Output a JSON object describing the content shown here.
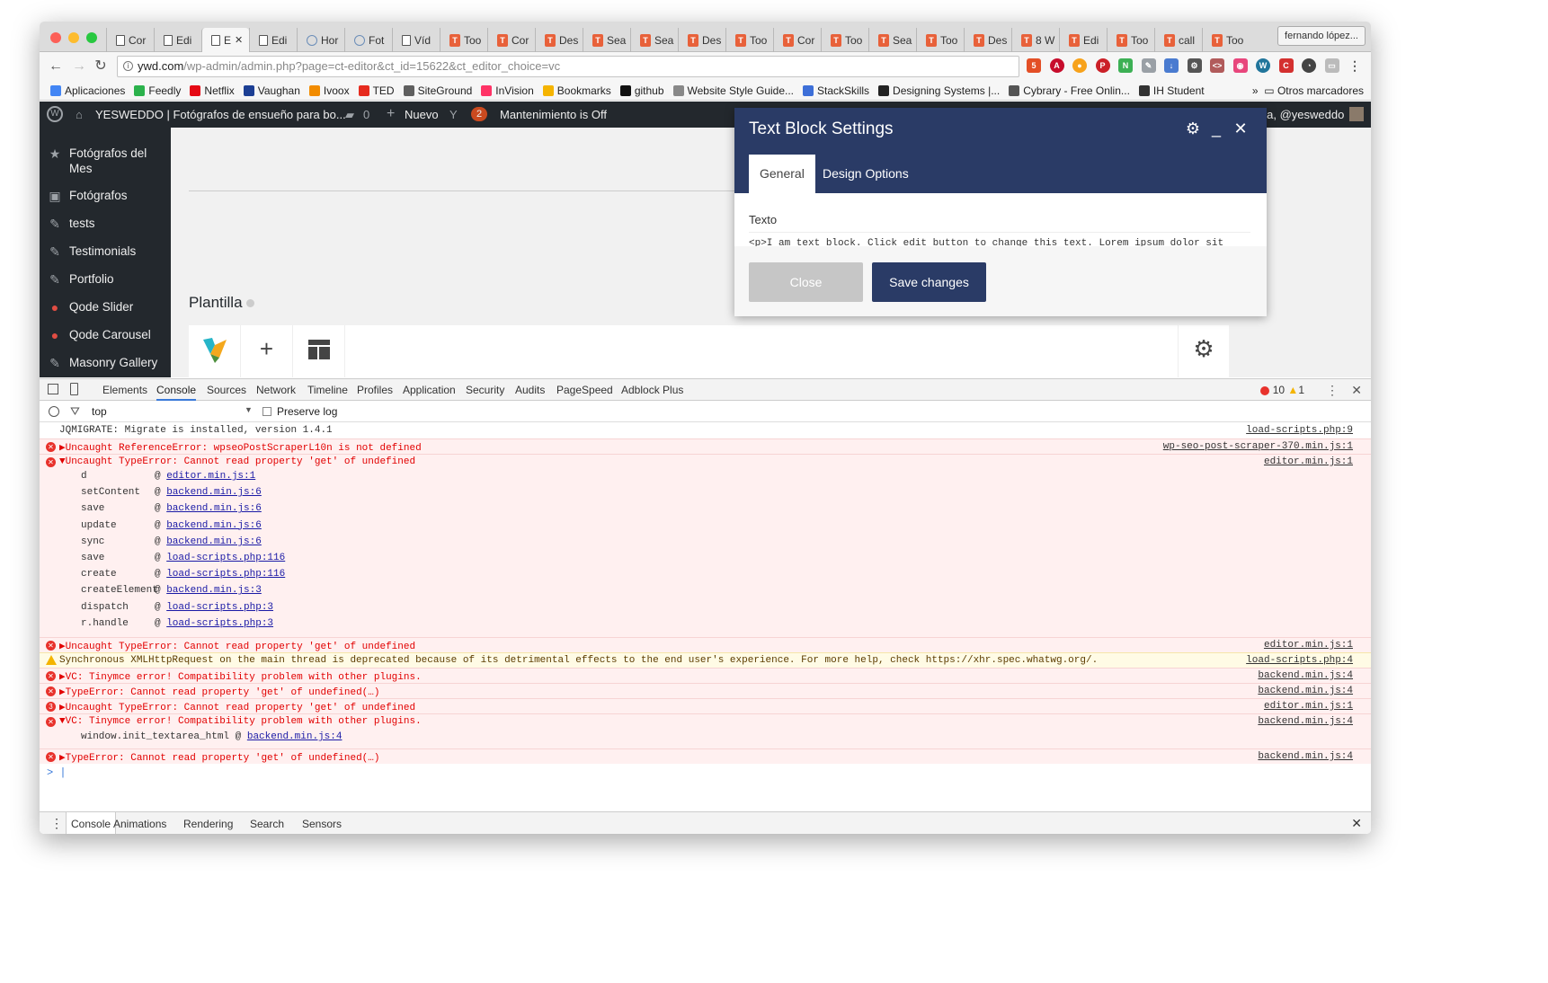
{
  "browser": {
    "tabs": [
      {
        "label": "Cor",
        "icon": "doc"
      },
      {
        "label": "Edi",
        "icon": "doc"
      },
      {
        "label": "E",
        "icon": "doc",
        "active": true
      },
      {
        "label": "Edi",
        "icon": "doc"
      },
      {
        "label": "Hor",
        "icon": "globe"
      },
      {
        "label": "Fot",
        "icon": "globe"
      },
      {
        "label": "Víd",
        "icon": "doc"
      },
      {
        "label": "Too",
        "icon": "toolset"
      },
      {
        "label": "Cor",
        "icon": "toolset"
      },
      {
        "label": "Des",
        "icon": "toolset"
      },
      {
        "label": "Sea",
        "icon": "toolset"
      },
      {
        "label": "Sea",
        "icon": "toolset"
      },
      {
        "label": "Des",
        "icon": "toolset"
      },
      {
        "label": "Too",
        "icon": "toolset"
      },
      {
        "label": "Cor",
        "icon": "toolset"
      },
      {
        "label": "Too",
        "icon": "toolset"
      },
      {
        "label": "Sea",
        "icon": "toolset"
      },
      {
        "label": "Too",
        "icon": "toolset"
      },
      {
        "label": "Des",
        "icon": "toolset"
      },
      {
        "label": "8 W",
        "icon": "toolset"
      },
      {
        "label": "Edi",
        "icon": "toolset"
      },
      {
        "label": "Too",
        "icon": "toolset"
      },
      {
        "label": "call",
        "icon": "toolset"
      },
      {
        "label": "Too",
        "icon": "toolset"
      }
    ],
    "profile": "fernando lópez...",
    "url_host": "ywd.com",
    "url_path": "/wp-admin/admin.php?page=ct-editor&ct_id=15622&ct_editor_choice=vc",
    "bookmarks": [
      {
        "label": "Aplicaciones",
        "color": "#4285f4"
      },
      {
        "label": "Feedly",
        "color": "#2bb24c"
      },
      {
        "label": "Netflix",
        "color": "#e50914"
      },
      {
        "label": "Vaughan",
        "color": "#1c3f94"
      },
      {
        "label": "Ivoox",
        "color": "#f28c00"
      },
      {
        "label": "TED",
        "color": "#e62b1e"
      },
      {
        "label": "SiteGround",
        "color": "#5f5f5f"
      },
      {
        "label": "InVision",
        "color": "#ff3366"
      },
      {
        "label": "Bookmarks",
        "color": "#f5b400"
      },
      {
        "label": "github",
        "color": "#111111"
      },
      {
        "label": "Website Style Guide...",
        "color": "#888888"
      },
      {
        "label": "StackSkills",
        "color": "#3d6fd8"
      },
      {
        "label": "Designing Systems |...",
        "color": "#222222"
      },
      {
        "label": "Cybrary - Free Onlin...",
        "color": "#555555"
      },
      {
        "label": "IH Student",
        "color": "#333333"
      }
    ],
    "bookmarks_more": "»",
    "bookmarks_other": "Otros marcadores"
  },
  "adminbar": {
    "site": "YESWEDDO | Fotógrafos de ensueño para bo...",
    "comments": "0",
    "new": "Nuevo",
    "updates": "2",
    "maintenance": "Mantenimiento is Off",
    "greeting": "ola, @yesweddo"
  },
  "sidebar": {
    "items": [
      {
        "label": "Fotógrafos del",
        "label2": "Mes",
        "icon": "★"
      },
      {
        "label": "Fotógrafos",
        "icon": "▣"
      },
      {
        "label": "tests",
        "icon": "✎"
      },
      {
        "label": "Testimonials",
        "icon": "✎"
      },
      {
        "label": "Portfolio",
        "icon": "✎"
      },
      {
        "label": "Qode Slider",
        "icon": "●"
      },
      {
        "label": "Qode Carousel",
        "icon": "●"
      },
      {
        "label": "Masonry Gallery",
        "icon": "✎"
      }
    ]
  },
  "content": {
    "plantilla": "Plantilla"
  },
  "dialog": {
    "title": "Text Block Settings",
    "tab_general": "General",
    "tab_design": "Design Options",
    "field_label": "Texto",
    "field_value": "<p>I am text block. Click edit button to change this text. Lorem ipsum dolor sit",
    "close_label": "Close",
    "save_label": "Save changes"
  },
  "devtools": {
    "tabs": [
      "Elements",
      "Console",
      "Sources",
      "Network",
      "Timeline",
      "Profiles",
      "Application",
      "Security",
      "Audits",
      "PageSpeed",
      "Adblock Plus"
    ],
    "active_tab": "Console",
    "error_count": "10",
    "warning_count": "1",
    "context": "top",
    "preserve_log": "Preserve log",
    "drawer_tabs": [
      "Console",
      "Animations",
      "Rendering",
      "Search",
      "Sensors"
    ]
  },
  "console": {
    "logs": [
      {
        "type": "info",
        "text": "JQMIGRATE: Migrate is installed, version 1.4.1",
        "src": "load-scripts.php:9"
      },
      {
        "type": "err",
        "text": "▶Uncaught ReferenceError: wpseoPostScraperL10n is not defined",
        "src": "wp-seo-post-scraper-370.min.js:1"
      },
      {
        "type": "err",
        "text": "▼Uncaught TypeError: Cannot read property 'get' of undefined",
        "src": "editor.min.js:1"
      },
      {
        "type": "err",
        "text": "▶Uncaught TypeError: Cannot read property 'get' of undefined",
        "src": "editor.min.js:1"
      },
      {
        "type": "warn",
        "text": "Synchronous XMLHttpRequest on the main thread is deprecated because of its detrimental effects to the end user's experience. For more help, check https://xhr.spec.whatwg.org/.",
        "src": "load-scripts.php:4"
      },
      {
        "type": "err",
        "text": "▶VC: Tinymce error! Compatibility problem with other plugins.",
        "src": "backend.min.js:4"
      },
      {
        "type": "err",
        "text": "▶TypeError: Cannot read property 'get' of undefined(…)",
        "src": "backend.min.js:4"
      },
      {
        "type": "err",
        "text": "▶Uncaught TypeError: Cannot read property 'get' of undefined",
        "src": "editor.min.js:1",
        "repeat": "3"
      },
      {
        "type": "err",
        "text": "▼VC: Tinymce error! Compatibility problem with other plugins.",
        "src": "backend.min.js:4"
      },
      {
        "type": "err",
        "text": "▶TypeError: Cannot read property 'get' of undefined(…)",
        "src": "backend.min.js:4"
      }
    ],
    "stack": [
      {
        "fn": "d",
        "loc": "editor.min.js:1"
      },
      {
        "fn": "setContent",
        "loc": "backend.min.js:6"
      },
      {
        "fn": "save",
        "loc": "backend.min.js:6"
      },
      {
        "fn": "update",
        "loc": "backend.min.js:6"
      },
      {
        "fn": "sync",
        "loc": "backend.min.js:6"
      },
      {
        "fn": "save",
        "loc": "load-scripts.php:116"
      },
      {
        "fn": "create",
        "loc": "load-scripts.php:116"
      },
      {
        "fn": "createElement",
        "loc": "backend.min.js:3"
      },
      {
        "fn": "dispatch",
        "loc": "load-scripts.php:3"
      },
      {
        "fn": "r.handle",
        "loc": "load-scripts.php:3"
      }
    ],
    "stack2": {
      "fn": "window.init_textarea_html",
      "loc": "backend.min.js:4"
    },
    "prompt": ">"
  }
}
